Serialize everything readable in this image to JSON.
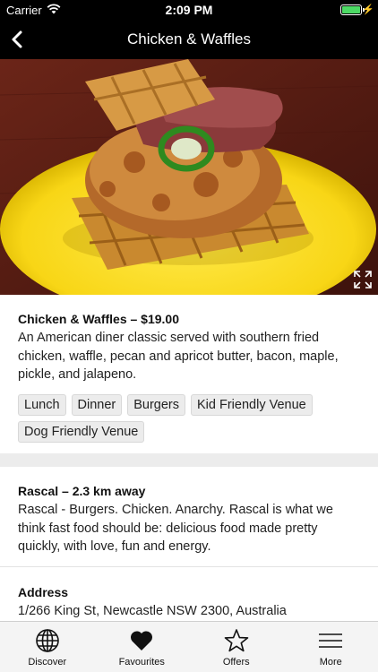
{
  "status_bar": {
    "carrier": "Carrier",
    "time": "2:09 PM",
    "battery_level": 1.0,
    "battery_color": "#4cd964"
  },
  "nav": {
    "title": "Chicken & Waffles",
    "back_icon": "chevron-left-icon"
  },
  "hero": {
    "image_subject": "Chicken and waffle sandwich on a yellow plate",
    "expand_icon": "expand-icon"
  },
  "item": {
    "heading": "Chicken & Waffles – $19.00",
    "description": "An American diner classic served with southern fried chicken, waffle, pecan and apricot butter, bacon, maple, pickle, and jalapeno.",
    "tags": [
      "Lunch",
      "Dinner",
      "Burgers",
      "Kid Friendly Venue",
      "Dog Friendly Venue"
    ]
  },
  "venue": {
    "heading": "Rascal – 2.3 km away",
    "description": "Rascal - Burgers. Chicken. Anarchy. Rascal is what we think fast food should be: delicious food made pretty quickly, with love, fun and energy."
  },
  "address": {
    "heading": "Address",
    "value": "1/266 King St, Newcastle NSW 2300, Australia"
  },
  "tabbar": {
    "items": [
      {
        "label": "Discover",
        "icon": "globe-icon"
      },
      {
        "label": "Favourites",
        "icon": "heart-icon"
      },
      {
        "label": "Offers",
        "icon": "star-icon"
      },
      {
        "label": "More",
        "icon": "menu-icon"
      }
    ]
  }
}
